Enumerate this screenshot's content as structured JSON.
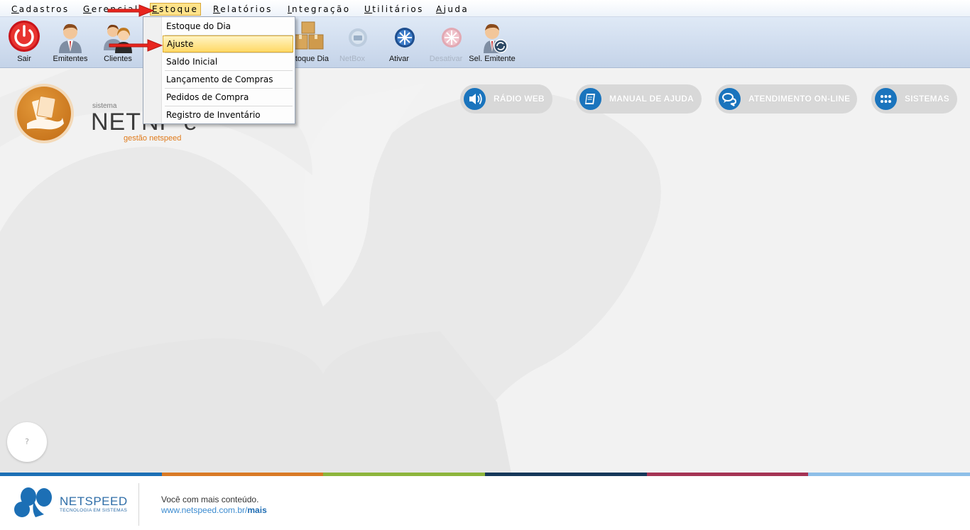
{
  "menu": {
    "items": [
      {
        "label": "Cadastros"
      },
      {
        "label": "Gerencial"
      },
      {
        "label": "Estoque"
      },
      {
        "label": "Relatórios"
      },
      {
        "label": "Integração"
      },
      {
        "label": "Utilitários"
      },
      {
        "label": "Ajuda"
      }
    ]
  },
  "toolbar": {
    "buttons": [
      {
        "label": "Sair",
        "icon": "power-icon"
      },
      {
        "label": "Emitentes",
        "icon": "businessman-icon"
      },
      {
        "label": "Clientes",
        "icon": "clients-icon"
      },
      {
        "label": "Estoque Dia",
        "icon": "boxes-icon"
      },
      {
        "label": "NetBox",
        "icon": "netbox-icon"
      },
      {
        "label": "Ativar",
        "icon": "activate-icon"
      },
      {
        "label": "Desativar",
        "icon": "deactivate-icon"
      },
      {
        "label": "Sel. Emitente",
        "icon": "select-issuer-icon"
      }
    ]
  },
  "dropdown": {
    "items": [
      {
        "label": "Estoque do Dia"
      },
      {
        "label": "Ajuste"
      },
      {
        "label": "Saldo Inicial"
      },
      {
        "label": "Lançamento de Compras"
      },
      {
        "label": "Pedidos de Compra"
      },
      {
        "label": "Registro de Inventário"
      }
    ],
    "selected": "Ajuste"
  },
  "brand": {
    "small": "sistema",
    "big": "NETNF-e",
    "sub": "gestão netspeed"
  },
  "quick_links": [
    {
      "label": "RÁDIO WEB",
      "icon": "speaker-icon"
    },
    {
      "label": "MANUAL DE AJUDA",
      "icon": "book-icon"
    },
    {
      "label": "ATENDIMENTO ON-LINE",
      "icon": "chat-icon"
    },
    {
      "label": "SISTEMAS",
      "icon": "apps-grid-icon"
    }
  ],
  "help_button": {
    "label": "?"
  },
  "footer": {
    "company": "NETSPEED",
    "tagline": "TECNOLOGIA EM SISTEMAS",
    "line1": "Você com mais conteúdo.",
    "url_prefix": "www.netspeed.com.br/",
    "url_suffix": "mais"
  },
  "colors": {
    "stripe": [
      "#1c6fb5",
      "#d97a26",
      "#8db53c",
      "#16385a",
      "#a53455",
      "#8ebfe8"
    ],
    "accent_blue": "#1a74bd",
    "brand_orange": "#e07a1a",
    "menu_active": "#ffe38a",
    "arrow_red": "#e8251e"
  }
}
